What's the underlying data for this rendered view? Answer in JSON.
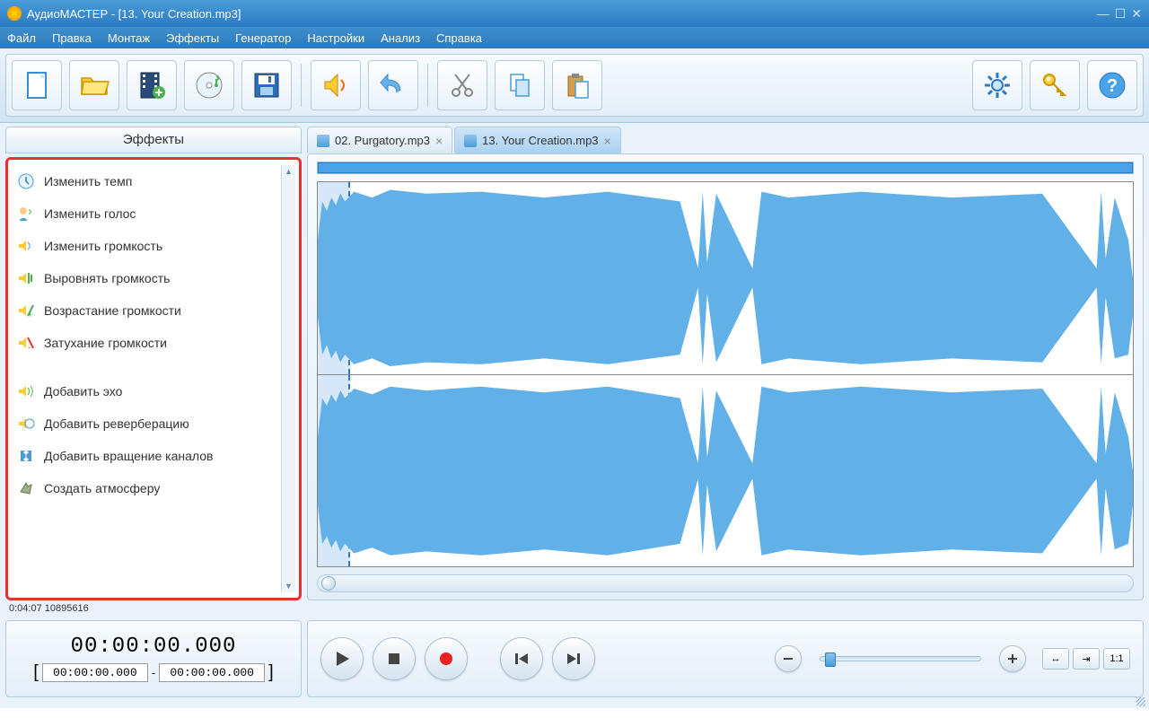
{
  "window": {
    "title": "АудиоМАСТЕР - [13. Your Creation.mp3]"
  },
  "menu": [
    "Файл",
    "Правка",
    "Монтаж",
    "Эффекты",
    "Генератор",
    "Настройки",
    "Анализ",
    "Справка"
  ],
  "sidebar": {
    "header": "Эффекты",
    "groups": [
      [
        "Изменить темп",
        "Изменить голос",
        "Изменить громкость",
        "Выровнять громкость",
        "Возрастание громкости",
        "Затухание громкости"
      ],
      [
        "Добавить эхо",
        "Добавить реверберацию",
        "Добавить вращение каналов",
        "Создать атмосферу"
      ]
    ]
  },
  "tabs": [
    {
      "label": "02. Purgatory.mp3",
      "active": false
    },
    {
      "label": "13. Your Creation.mp3",
      "active": true
    }
  ],
  "status": "0:04:07 10895616",
  "time": {
    "main": "00:00:00.000",
    "sel_start": "00:00:00.000",
    "sel_end": "00:00:00.000"
  },
  "view_buttons": [
    "↔",
    "⇥",
    "1:1"
  ]
}
